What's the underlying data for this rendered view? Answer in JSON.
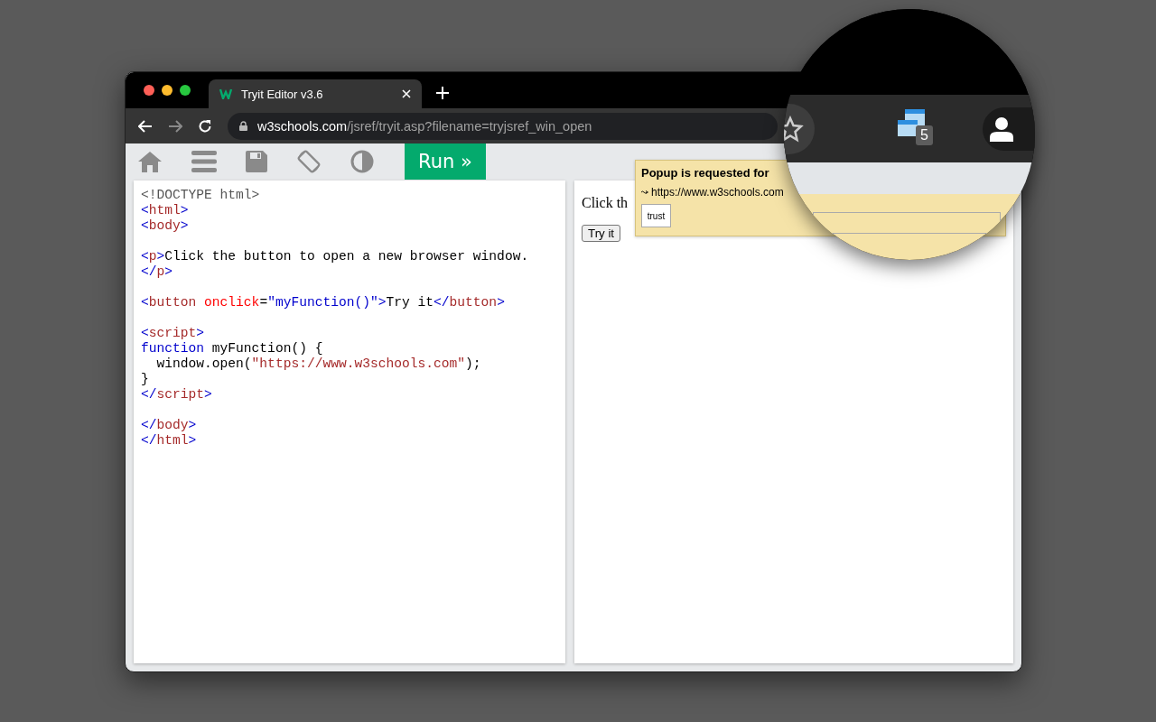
{
  "browser": {
    "tab": {
      "title": "Tryit Editor v3.6",
      "selected": true
    },
    "address": {
      "domain": "w3schools.com",
      "path": "/jsref/tryit.asp?filename=tryjsref_win_open"
    }
  },
  "toolbar": {
    "run_button": "Run »"
  },
  "code_lines": [
    {
      "kind": "code",
      "tokens": [
        {
          "kind": "doctype",
          "text": "<!DOCTYPE html>"
        }
      ]
    },
    {
      "kind": "code",
      "tokens": [
        {
          "kind": "bracket",
          "text": "<"
        },
        {
          "kind": "tag",
          "text": "html"
        },
        {
          "kind": "bracket",
          "text": ">"
        }
      ]
    },
    {
      "kind": "code",
      "tokens": [
        {
          "kind": "bracket",
          "text": "<"
        },
        {
          "kind": "tag",
          "text": "body"
        },
        {
          "kind": "bracket",
          "text": ">"
        }
      ]
    },
    {
      "kind": "blank"
    },
    {
      "kind": "code",
      "tokens": [
        {
          "kind": "bracket",
          "text": "<"
        },
        {
          "kind": "tag",
          "text": "p"
        },
        {
          "kind": "bracket",
          "text": ">"
        },
        {
          "kind": "text",
          "text": "Click the button to open a new browser window."
        }
      ]
    },
    {
      "kind": "code",
      "tokens": [
        {
          "kind": "bracket",
          "text": "</"
        },
        {
          "kind": "tag",
          "text": "p"
        },
        {
          "kind": "bracket",
          "text": ">"
        }
      ]
    },
    {
      "kind": "blank"
    },
    {
      "kind": "code",
      "tokens": [
        {
          "kind": "bracket",
          "text": "<"
        },
        {
          "kind": "tag",
          "text": "button"
        },
        {
          "kind": "attr",
          "text": " onclick"
        },
        {
          "kind": "text",
          "text": "="
        },
        {
          "kind": "value",
          "text": "\"myFunction()\""
        },
        {
          "kind": "bracket",
          "text": ">"
        },
        {
          "kind": "text",
          "text": "Try it"
        },
        {
          "kind": "bracket",
          "text": "</"
        },
        {
          "kind": "tag",
          "text": "button"
        },
        {
          "kind": "bracket",
          "text": ">"
        }
      ]
    },
    {
      "kind": "blank"
    },
    {
      "kind": "code",
      "tokens": [
        {
          "kind": "bracket",
          "text": "<"
        },
        {
          "kind": "tag",
          "text": "script"
        },
        {
          "kind": "bracket",
          "text": ">"
        }
      ]
    },
    {
      "kind": "code",
      "tokens": [
        {
          "kind": "keyword",
          "text": "function"
        },
        {
          "kind": "text",
          "text": " myFunction() {"
        }
      ]
    },
    {
      "kind": "code",
      "tokens": [
        {
          "kind": "text",
          "text": "  window.open("
        },
        {
          "kind": "string",
          "text": "\"https://www.w3schools.com\""
        },
        {
          "kind": "text",
          "text": ");"
        }
      ]
    },
    {
      "kind": "code",
      "tokens": [
        {
          "kind": "text",
          "text": "}"
        }
      ]
    },
    {
      "kind": "code",
      "tokens": [
        {
          "kind": "bracket",
          "text": "</"
        },
        {
          "kind": "tag",
          "text": "script"
        },
        {
          "kind": "bracket",
          "text": ">"
        }
      ]
    },
    {
      "kind": "blank"
    },
    {
      "kind": "code",
      "tokens": [
        {
          "kind": "bracket",
          "text": "</"
        },
        {
          "kind": "tag",
          "text": "body"
        },
        {
          "kind": "bracket",
          "text": ">"
        }
      ]
    },
    {
      "kind": "code",
      "tokens": [
        {
          "kind": "bracket",
          "text": "</"
        },
        {
          "kind": "tag",
          "text": "html"
        },
        {
          "kind": "bracket",
          "text": ">"
        }
      ]
    }
  ],
  "result": {
    "paragraph": "Click th",
    "button": "Try it"
  },
  "popup": {
    "title": "Popup is requested for",
    "url": "https://www.w3schools.com",
    "trust_button": "trust"
  },
  "magnifier": {
    "badge": "5"
  }
}
